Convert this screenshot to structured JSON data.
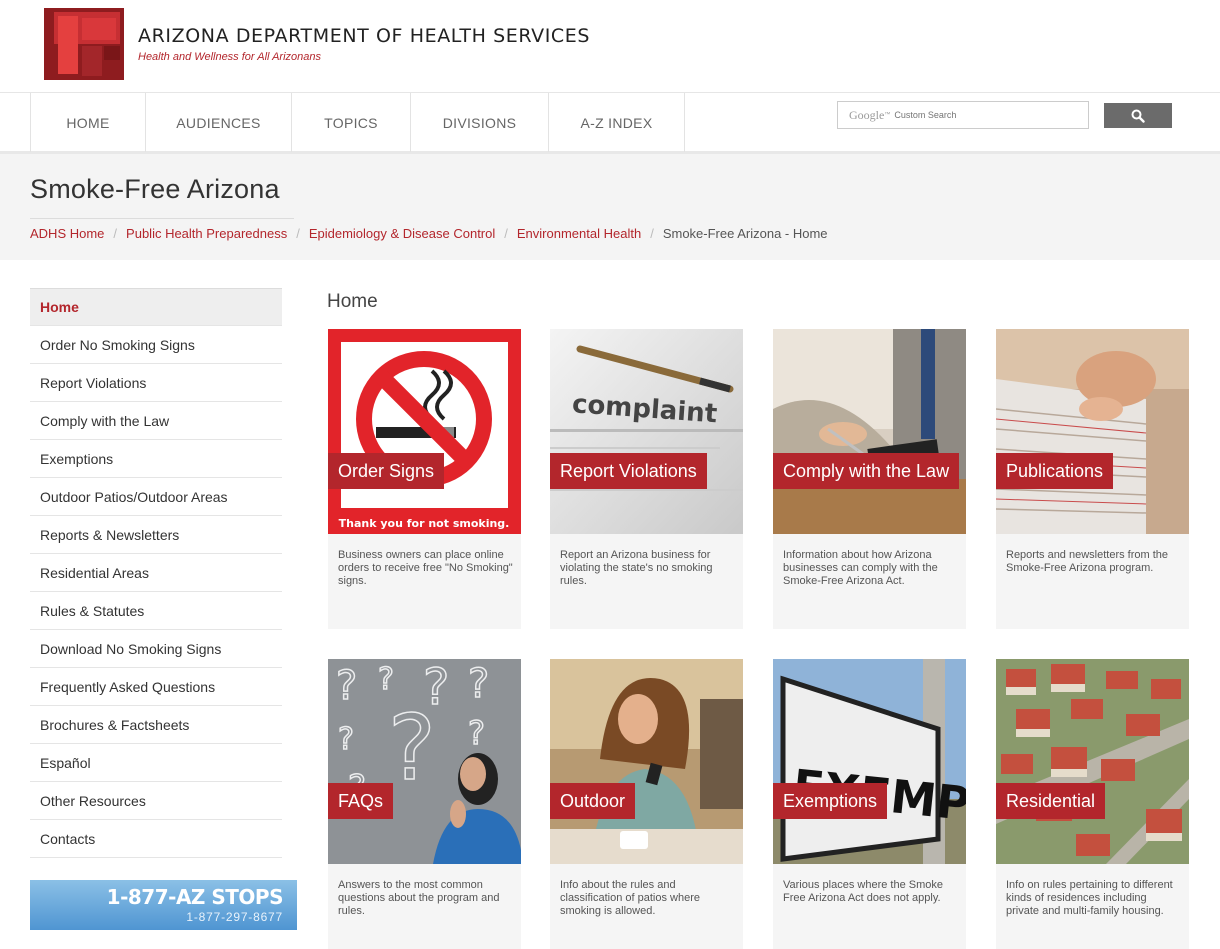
{
  "header": {
    "org_name": "ARIZONA DEPARTMENT OF HEALTH SERVICES",
    "tagline": "Health and Wellness for All Arizonans",
    "logo_icon": "adhs-logo"
  },
  "nav": {
    "items": [
      {
        "label": "HOME"
      },
      {
        "label": "AUDIENCES"
      },
      {
        "label": "TOPICS"
      },
      {
        "label": "DIVISIONS"
      },
      {
        "label": "A-Z INDEX"
      }
    ],
    "search": {
      "brand": "Google",
      "brand_tm": "™",
      "placeholder": "Custom Search",
      "button_icon": "search-icon"
    }
  },
  "page": {
    "title": "Smoke-Free Arizona",
    "breadcrumb": [
      {
        "label": "ADHS Home"
      },
      {
        "label": "Public Health Preparedness"
      },
      {
        "label": "Epidemiology & Disease Control"
      },
      {
        "label": "Environmental Health"
      }
    ],
    "breadcrumb_current": "Smoke-Free Arizona - Home",
    "breadcrumb_separator": "/"
  },
  "sidebar": {
    "items": [
      {
        "label": "Home"
      },
      {
        "label": "Order No Smoking Signs"
      },
      {
        "label": "Report Violations"
      },
      {
        "label": "Comply with the Law"
      },
      {
        "label": "Exemptions"
      },
      {
        "label": "Outdoor Patios/Outdoor Areas"
      },
      {
        "label": "Reports & Newsletters"
      },
      {
        "label": "Residential Areas"
      },
      {
        "label": "Rules & Statutes"
      },
      {
        "label": "Download No Smoking Signs"
      },
      {
        "label": "Frequently Asked Questions"
      },
      {
        "label": "Brochures & Factsheets"
      },
      {
        "label": "Español"
      },
      {
        "label": "Other Resources"
      },
      {
        "label": "Contacts"
      }
    ],
    "phone_banner": {
      "main": "1-877-AZ STOPS",
      "sub": "1-877-297-8677"
    }
  },
  "content": {
    "heading": "Home",
    "cards": [
      {
        "label": "Order Signs",
        "description": "Business owners can place online orders to receive free \"No Smoking\" signs.",
        "sign_caption": "Thank you for not smoking.",
        "image_icon": "no-smoking-sign"
      },
      {
        "label": "Report Violations",
        "description": "Report an Arizona business for violating the state's no smoking rules.",
        "image_word": "complaint",
        "image_icon": "complaint-form-photo"
      },
      {
        "label": "Comply with the Law",
        "description": "Information about how Arizona businesses can comply with the Smoke-Free Arizona Act.",
        "image_icon": "business-person-photo"
      },
      {
        "label": "Publications",
        "description": "Reports and newsletters from the Smoke-Free Arizona program.",
        "image_icon": "paper-stack-photo"
      },
      {
        "label": "FAQs",
        "description": "Answers to the most common questions about the program and rules.",
        "image_icon": "question-marks-photo"
      },
      {
        "label": "Outdoor",
        "description": "Info about the rules and classification of patios where smoking is allowed.",
        "image_icon": "outdoor-cafe-photo"
      },
      {
        "label": "Exemptions",
        "description": "Various places where the Smoke Free Arizona Act does not apply.",
        "image_word": "EXEMPT",
        "image_icon": "exempt-sign-photo"
      },
      {
        "label": "Residential",
        "description": "Info on rules pertaining to different kinds of residences including private and multi-family housing.",
        "image_icon": "houses-aerial-photo"
      }
    ]
  },
  "colors": {
    "brand_red": "#b3262c",
    "nav_text": "#666666",
    "search_button": "#6b6b6b",
    "title_band": "#f4f4f4",
    "banner_blue": "#4f95d2"
  }
}
